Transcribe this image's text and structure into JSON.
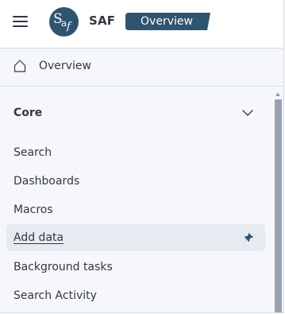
{
  "header": {
    "menu_icon": "hamburger-menu-icon",
    "logo_text": "Saf",
    "app_name": "SAF",
    "breadcrumb": "Overview",
    "accent_color": "#2f5470"
  },
  "overview": {
    "icon": "home-icon",
    "label": "Overview"
  },
  "nav": {
    "group": {
      "title": "Core",
      "chevron_icon": "chevron-down-icon",
      "expanded": true
    },
    "items": [
      {
        "label": "Search"
      },
      {
        "label": "Dashboards"
      },
      {
        "label": "Macros"
      },
      {
        "label": "Add data",
        "active": true,
        "pinned": true,
        "pin_icon": "pin-icon"
      },
      {
        "label": "Background tasks"
      },
      {
        "label": "Search Activity"
      }
    ]
  }
}
